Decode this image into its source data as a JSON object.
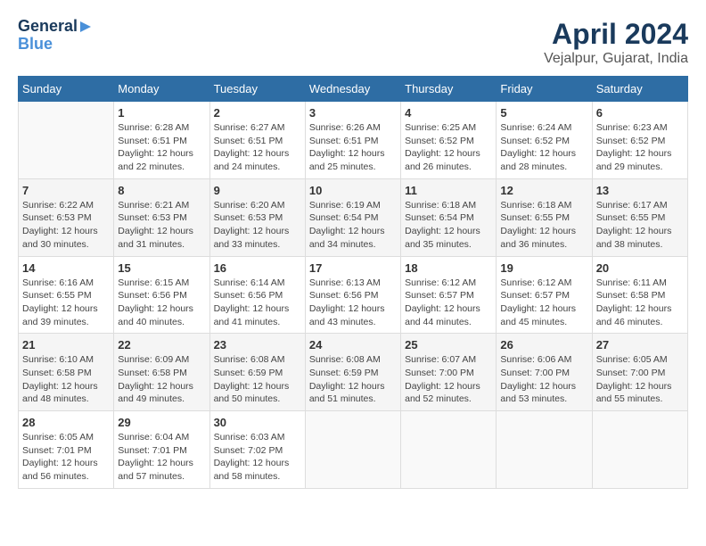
{
  "header": {
    "logo_line1": "General",
    "logo_line2": "Blue",
    "title": "April 2024",
    "subtitle": "Vejalpur, Gujarat, India"
  },
  "calendar": {
    "days_of_week": [
      "Sunday",
      "Monday",
      "Tuesday",
      "Wednesday",
      "Thursday",
      "Friday",
      "Saturday"
    ],
    "weeks": [
      [
        {
          "day": "",
          "info": ""
        },
        {
          "day": "1",
          "info": "Sunrise: 6:28 AM\nSunset: 6:51 PM\nDaylight: 12 hours\nand 22 minutes."
        },
        {
          "day": "2",
          "info": "Sunrise: 6:27 AM\nSunset: 6:51 PM\nDaylight: 12 hours\nand 24 minutes."
        },
        {
          "day": "3",
          "info": "Sunrise: 6:26 AM\nSunset: 6:51 PM\nDaylight: 12 hours\nand 25 minutes."
        },
        {
          "day": "4",
          "info": "Sunrise: 6:25 AM\nSunset: 6:52 PM\nDaylight: 12 hours\nand 26 minutes."
        },
        {
          "day": "5",
          "info": "Sunrise: 6:24 AM\nSunset: 6:52 PM\nDaylight: 12 hours\nand 28 minutes."
        },
        {
          "day": "6",
          "info": "Sunrise: 6:23 AM\nSunset: 6:52 PM\nDaylight: 12 hours\nand 29 minutes."
        }
      ],
      [
        {
          "day": "7",
          "info": "Sunrise: 6:22 AM\nSunset: 6:53 PM\nDaylight: 12 hours\nand 30 minutes."
        },
        {
          "day": "8",
          "info": "Sunrise: 6:21 AM\nSunset: 6:53 PM\nDaylight: 12 hours\nand 31 minutes."
        },
        {
          "day": "9",
          "info": "Sunrise: 6:20 AM\nSunset: 6:53 PM\nDaylight: 12 hours\nand 33 minutes."
        },
        {
          "day": "10",
          "info": "Sunrise: 6:19 AM\nSunset: 6:54 PM\nDaylight: 12 hours\nand 34 minutes."
        },
        {
          "day": "11",
          "info": "Sunrise: 6:18 AM\nSunset: 6:54 PM\nDaylight: 12 hours\nand 35 minutes."
        },
        {
          "day": "12",
          "info": "Sunrise: 6:18 AM\nSunset: 6:55 PM\nDaylight: 12 hours\nand 36 minutes."
        },
        {
          "day": "13",
          "info": "Sunrise: 6:17 AM\nSunset: 6:55 PM\nDaylight: 12 hours\nand 38 minutes."
        }
      ],
      [
        {
          "day": "14",
          "info": "Sunrise: 6:16 AM\nSunset: 6:55 PM\nDaylight: 12 hours\nand 39 minutes."
        },
        {
          "day": "15",
          "info": "Sunrise: 6:15 AM\nSunset: 6:56 PM\nDaylight: 12 hours\nand 40 minutes."
        },
        {
          "day": "16",
          "info": "Sunrise: 6:14 AM\nSunset: 6:56 PM\nDaylight: 12 hours\nand 41 minutes."
        },
        {
          "day": "17",
          "info": "Sunrise: 6:13 AM\nSunset: 6:56 PM\nDaylight: 12 hours\nand 43 minutes."
        },
        {
          "day": "18",
          "info": "Sunrise: 6:12 AM\nSunset: 6:57 PM\nDaylight: 12 hours\nand 44 minutes."
        },
        {
          "day": "19",
          "info": "Sunrise: 6:12 AM\nSunset: 6:57 PM\nDaylight: 12 hours\nand 45 minutes."
        },
        {
          "day": "20",
          "info": "Sunrise: 6:11 AM\nSunset: 6:58 PM\nDaylight: 12 hours\nand 46 minutes."
        }
      ],
      [
        {
          "day": "21",
          "info": "Sunrise: 6:10 AM\nSunset: 6:58 PM\nDaylight: 12 hours\nand 48 minutes."
        },
        {
          "day": "22",
          "info": "Sunrise: 6:09 AM\nSunset: 6:58 PM\nDaylight: 12 hours\nand 49 minutes."
        },
        {
          "day": "23",
          "info": "Sunrise: 6:08 AM\nSunset: 6:59 PM\nDaylight: 12 hours\nand 50 minutes."
        },
        {
          "day": "24",
          "info": "Sunrise: 6:08 AM\nSunset: 6:59 PM\nDaylight: 12 hours\nand 51 minutes."
        },
        {
          "day": "25",
          "info": "Sunrise: 6:07 AM\nSunset: 7:00 PM\nDaylight: 12 hours\nand 52 minutes."
        },
        {
          "day": "26",
          "info": "Sunrise: 6:06 AM\nSunset: 7:00 PM\nDaylight: 12 hours\nand 53 minutes."
        },
        {
          "day": "27",
          "info": "Sunrise: 6:05 AM\nSunset: 7:00 PM\nDaylight: 12 hours\nand 55 minutes."
        }
      ],
      [
        {
          "day": "28",
          "info": "Sunrise: 6:05 AM\nSunset: 7:01 PM\nDaylight: 12 hours\nand 56 minutes."
        },
        {
          "day": "29",
          "info": "Sunrise: 6:04 AM\nSunset: 7:01 PM\nDaylight: 12 hours\nand 57 minutes."
        },
        {
          "day": "30",
          "info": "Sunrise: 6:03 AM\nSunset: 7:02 PM\nDaylight: 12 hours\nand 58 minutes."
        },
        {
          "day": "",
          "info": ""
        },
        {
          "day": "",
          "info": ""
        },
        {
          "day": "",
          "info": ""
        },
        {
          "day": "",
          "info": ""
        }
      ]
    ]
  }
}
